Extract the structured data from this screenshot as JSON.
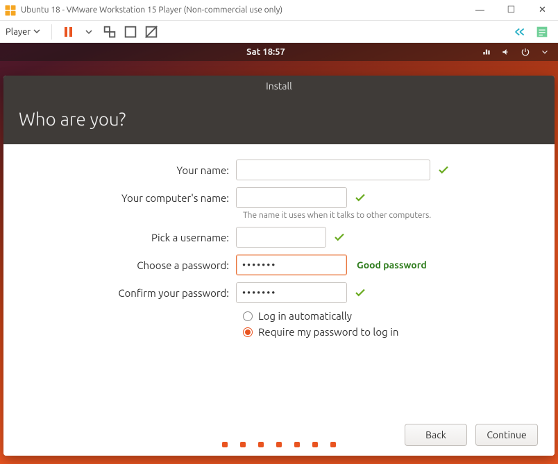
{
  "vmware": {
    "title": "Ubuntu 18 - VMware Workstation 15 Player (Non-commercial use only)",
    "player_label": "Player"
  },
  "ubuntu": {
    "clock": "Sat 18:57",
    "installer_title": "Install",
    "heading": "Who are you?",
    "labels": {
      "name": "Your name:",
      "computer": "Your computer's name:",
      "computer_hint": "The name it uses when it talks to other computers.",
      "username": "Pick a username:",
      "password": "Choose a password:",
      "confirm": "Confirm your password:"
    },
    "values": {
      "name": "",
      "computer": "",
      "username": "",
      "password": "•••••••",
      "confirm": "•••••••"
    },
    "password_status": "Good password",
    "radios": {
      "auto": "Log in automatically",
      "require": "Require my password to log in",
      "selected": "require"
    },
    "buttons": {
      "back": "Back",
      "continue": "Continue"
    }
  },
  "icons": {
    "net": "network-icon",
    "sound": "sound-icon",
    "power": "power-icon",
    "minimize": "—",
    "maximize": "☐",
    "close": "✕"
  }
}
